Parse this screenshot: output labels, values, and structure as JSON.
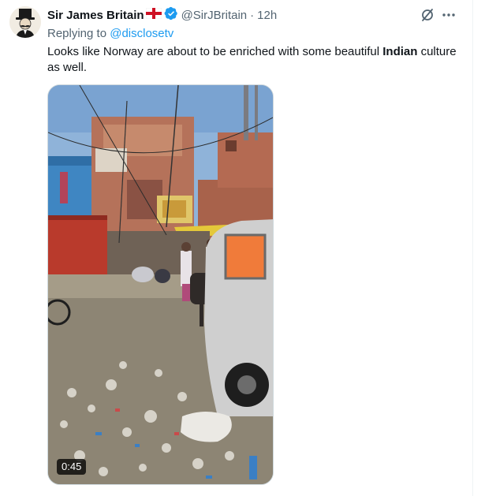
{
  "tweet": {
    "display_name": "Sir James Britain",
    "handle": "@SirJBritain",
    "separator": "·",
    "time": "12h",
    "replying_prefix": "Replying to ",
    "replying_to": "@disclosetv",
    "text_before": "Looks like Norway are about to be enriched with some beautiful ",
    "text_bold": "Indian",
    "text_after": " culture as well.",
    "video_duration": "0:45"
  },
  "icons": {
    "flag": "england-flag-icon",
    "verified": "verified-badge-icon",
    "grok": "grok-icon",
    "more": "more-icon"
  },
  "colors": {
    "verified": "#1d9bf0",
    "link": "#1d9bf0",
    "secondary_text": "#536471"
  }
}
